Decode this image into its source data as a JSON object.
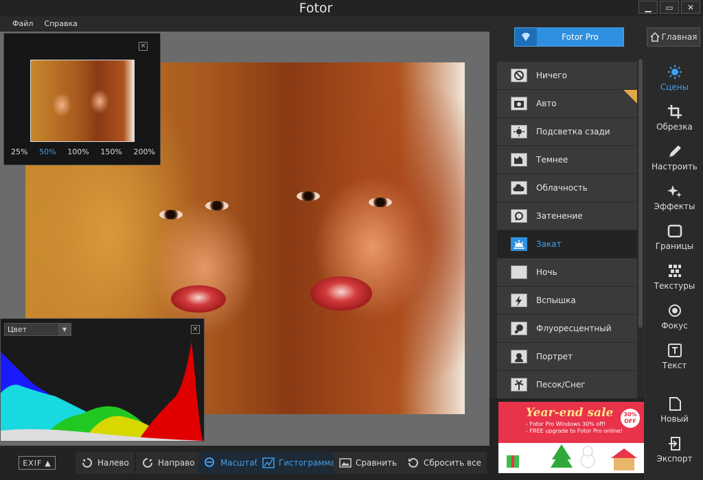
{
  "window": {
    "title": "Fotor",
    "minimize": "▁",
    "maximize": "▭",
    "close": "✕"
  },
  "menu": {
    "file": "Файл",
    "help": "Справка"
  },
  "navigator": {
    "zooms": [
      "25%",
      "50%",
      "100%",
      "150%",
      "200%"
    ],
    "active_zoom": "50%",
    "close": "✕"
  },
  "histogram": {
    "channel": "Цвет",
    "close": "✕"
  },
  "toolbar": {
    "exif": "EXIF",
    "rotate_left": "Налево",
    "rotate_right": "Направо",
    "zoom": "Масштаб",
    "histogram": "Гистограмма",
    "compare": "Сравнить",
    "reset": "Сбросить все"
  },
  "top_right": {
    "pro": "Fotor Pro",
    "home": "Главная"
  },
  "scenes": [
    {
      "label": "Ничего",
      "icon": "no-icon"
    },
    {
      "label": "Авто",
      "icon": "camera-icon",
      "premium": true
    },
    {
      "label": "Подсветка сзади",
      "icon": "backlight-icon"
    },
    {
      "label": "Темнее",
      "icon": "darker-icon"
    },
    {
      "label": "Облачность",
      "icon": "cloud-icon"
    },
    {
      "label": "Затенение",
      "icon": "shade-icon"
    },
    {
      "label": "Закат",
      "icon": "sunset-icon",
      "selected": true
    },
    {
      "label": "Ночь",
      "icon": "moon-icon"
    },
    {
      "label": "Вспышка",
      "icon": "flash-icon"
    },
    {
      "label": "Флуоресцентный",
      "icon": "bulb-icon"
    },
    {
      "label": "Портрет",
      "icon": "portrait-icon"
    },
    {
      "label": "Песок/Снег",
      "icon": "palm-icon"
    }
  ],
  "ad": {
    "headline": "Year-end sale",
    "line1": "- Fotor Pro Windows 30% off!",
    "line2": "- FREE upgrade to Fotor Pro online!",
    "badge": "30% OFF"
  },
  "right_nav": {
    "scenes": "Сцены",
    "crop": "Обрезка",
    "adjust": "Настроить",
    "effects": "Эффекты",
    "borders": "Границы",
    "textures": "Текстуры",
    "focus": "Фокус",
    "text": "Текст",
    "new": "Новый",
    "export": "Экспорт"
  },
  "colors": {
    "accent": "#3fa0f0",
    "pro_button": "#2f8fe0",
    "ad_bg": "#e8334a"
  }
}
